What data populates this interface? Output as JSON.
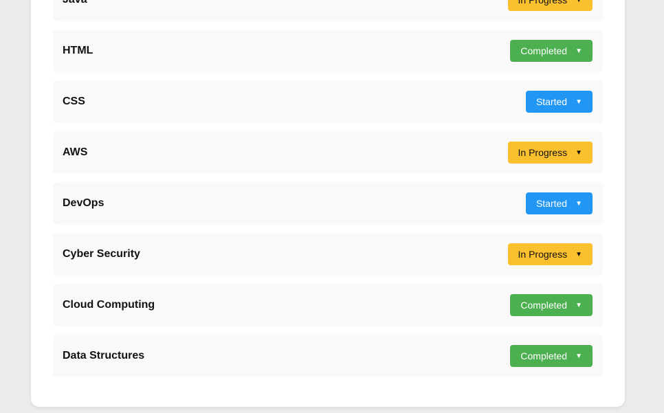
{
  "skills": [
    {
      "name": "Java",
      "status": "In Progress",
      "status_key": "inprogress"
    },
    {
      "name": "HTML",
      "status": "Completed",
      "status_key": "completed"
    },
    {
      "name": "CSS",
      "status": "Started",
      "status_key": "started"
    },
    {
      "name": "AWS",
      "status": "In Progress",
      "status_key": "inprogress"
    },
    {
      "name": "DevOps",
      "status": "Started",
      "status_key": "started"
    },
    {
      "name": "Cyber Security",
      "status": "In Progress",
      "status_key": "inprogress"
    },
    {
      "name": "Cloud Computing",
      "status": "Completed",
      "status_key": "completed"
    },
    {
      "name": "Data Structures",
      "status": "Completed",
      "status_key": "completed"
    }
  ],
  "caret_glyph": "▼",
  "colors": {
    "completed": "#4caf50",
    "started": "#2196f3",
    "in_progress": "#fbc02d"
  }
}
